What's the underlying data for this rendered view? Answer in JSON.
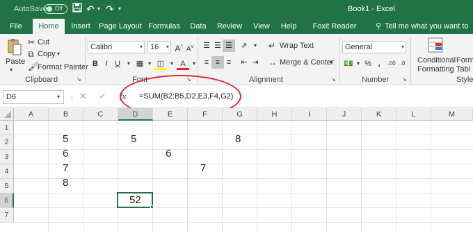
{
  "titlebar": {
    "autosave_label": "AutoSave",
    "autosave_state": "Off",
    "window_title": "Book1  -  Excel"
  },
  "tabs": [
    {
      "label": "File"
    },
    {
      "label": "Home"
    },
    {
      "label": "Insert"
    },
    {
      "label": "Page Layout"
    },
    {
      "label": "Formulas"
    },
    {
      "label": "Data"
    },
    {
      "label": "Review"
    },
    {
      "label": "View"
    },
    {
      "label": "Help"
    },
    {
      "label": "Foxit Reader PDF"
    }
  ],
  "tell_me": "Tell me what you want to do",
  "ribbon": {
    "clipboard": {
      "paste": "Paste",
      "cut": "Cut",
      "copy": "Copy",
      "format_painter": "Format Painter",
      "label": "Clipboard"
    },
    "font": {
      "name": "Calibri",
      "size": "16",
      "label": "Font"
    },
    "alignment": {
      "wrap_text": "Wrap Text",
      "merge_center": "Merge & Center",
      "label": "Alignment"
    },
    "number": {
      "format": "General",
      "label": "Number"
    },
    "styles": {
      "conditional_formatting_1": "Conditional",
      "conditional_formatting_2": "Formatting",
      "format_as_table_1": "Form",
      "format_as_table_2": "Tabl",
      "label": "Styles"
    }
  },
  "formula_bar": {
    "name_box": "D6",
    "fx": "fx",
    "formula": "=SUM(B2:B5,D2,E3,F4,G2)"
  },
  "sheet": {
    "columns": [
      "A",
      "B",
      "C",
      "D",
      "E",
      "F",
      "G",
      "H",
      "I",
      "J",
      "K",
      "L",
      "M"
    ],
    "rows": [
      "1",
      "2",
      "3",
      "4",
      "5",
      "6",
      "7"
    ],
    "cells": {
      "B2": "5",
      "D2": "5",
      "G2": "8",
      "B3": "6",
      "E3": "6",
      "B4": "7",
      "F4": "7",
      "B5": "8",
      "D6": "52"
    }
  },
  "colors": {
    "excel_green": "#217346",
    "annotation_red": "#e0252b"
  }
}
